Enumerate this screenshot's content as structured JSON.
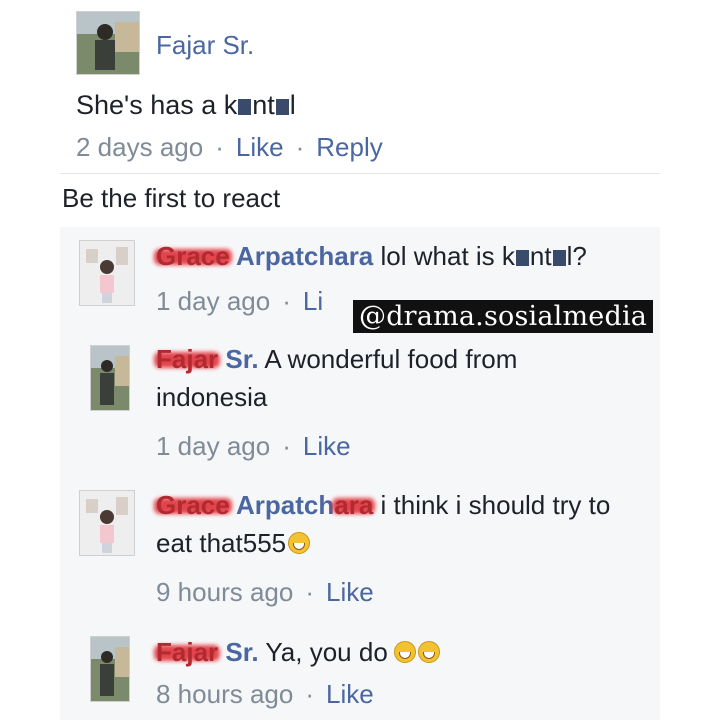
{
  "main_comment": {
    "author": "Fajar Sr.",
    "text_prefix": "She's has a k",
    "text_mid": "nt",
    "text_suffix": "l",
    "time": "2 days ago",
    "like": "Like",
    "reply": "Reply",
    "separator": "·"
  },
  "reactions_text": "Be the first to react",
  "replies": [
    {
      "author_redacted": "Grace",
      "author_visible": " Arpatchara",
      "text": " lol what is k",
      "text_mid": "nt",
      "text_end": "l?",
      "time": "1 day ago",
      "like": "Li"
    },
    {
      "author_redacted": "Fajar",
      "author_visible": " Sr.",
      "text": " A wonderful food from",
      "text_line2": "indonesia",
      "time": "1 day ago",
      "like": "Like"
    },
    {
      "author_redacted_a": "Grace",
      "author_visible": " Arpatch",
      "author_redacted_b": "ara",
      "text": " i think i should try to",
      "text_line2": "eat that555",
      "time": "9 hours ago",
      "like": "Like"
    },
    {
      "author_redacted": "Fajar",
      "author_visible": " Sr.",
      "text": " Ya, you do",
      "time": "8 hours ago",
      "like": "Like"
    }
  ],
  "watermark": "@drama.sosialmedia",
  "icons": {
    "avatar_main": "profile-photo",
    "avatar_grace": "profile-photo",
    "emoji": "grinning-sweat-emoji"
  },
  "colors": {
    "link": "#4b67a1",
    "meta": "#7f8b97",
    "redaction": "#e0252e",
    "reply_background": "#f6f7f9"
  }
}
